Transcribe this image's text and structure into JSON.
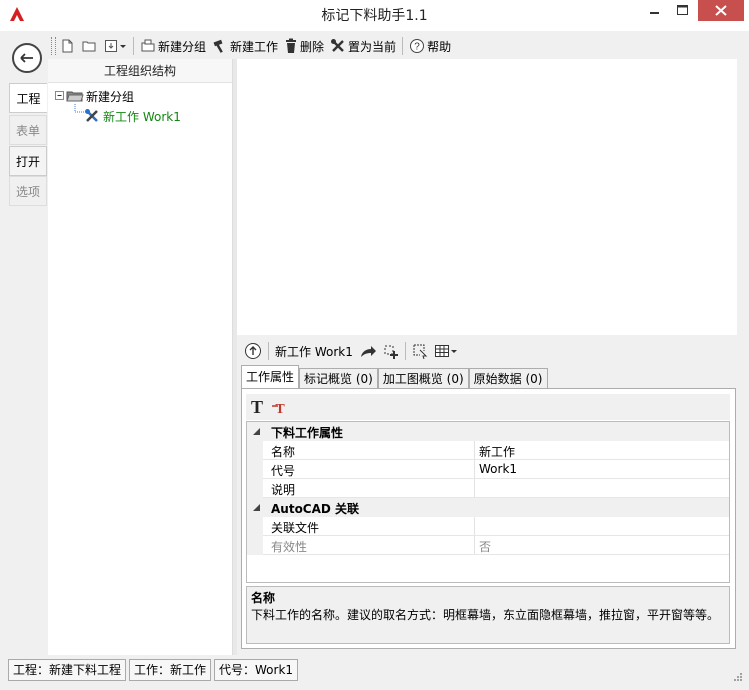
{
  "window": {
    "title": "标记下料助手1.1"
  },
  "sidebar": {
    "tabs": [
      {
        "label": "工程"
      },
      {
        "label": "表单"
      },
      {
        "label": "打开"
      },
      {
        "label": "选项"
      }
    ]
  },
  "toolbar": {
    "new_group": "新建分组",
    "new_work": "新建工作",
    "delete": "删除",
    "set_current": "置为当前",
    "help": "帮助"
  },
  "tree": {
    "header": "工程组织结构",
    "group_label": "新建分组",
    "work_label": "新工作 Work1",
    "work_color": "#118811"
  },
  "detail": {
    "current_label": "新工作 Work1",
    "tabs": [
      {
        "label": "工作属性"
      },
      {
        "label": "标记概览 (0)"
      },
      {
        "label": "加工图概览 (0)"
      },
      {
        "label": "原始数据 (0)"
      }
    ]
  },
  "properties": {
    "categories": [
      {
        "label": "下料工作属性"
      },
      {
        "label": "AutoCAD 关联"
      }
    ],
    "rows": [
      {
        "name": "名称",
        "value": "新工作"
      },
      {
        "name": "代号",
        "value": "Work1"
      },
      {
        "name": "说明",
        "value": ""
      },
      {
        "name": "关联文件",
        "value": ""
      },
      {
        "name": "有效性",
        "value": "否"
      }
    ],
    "description_title": "名称",
    "description_text": "下料工作的名称。建议的取名方式：明框幕墙，东立面隐框幕墙，推拉窗，平开窗等等。"
  },
  "statusbar": {
    "project": "工程：新建下料工程",
    "work": "工作：新工作",
    "code": "代号：Work1"
  },
  "colors": {
    "close_button": "#c7504f",
    "accent_red": "#c0392b"
  }
}
